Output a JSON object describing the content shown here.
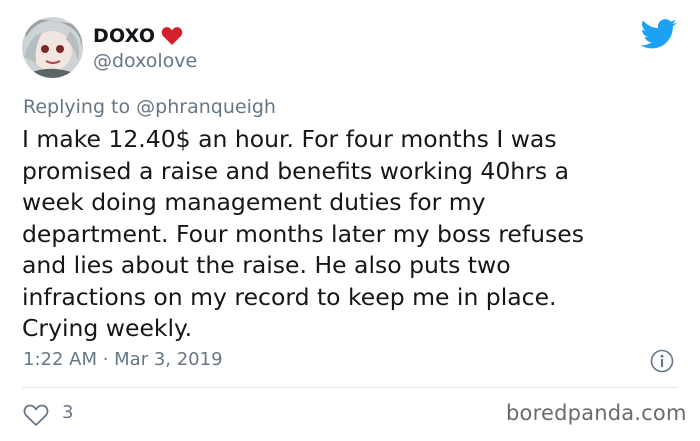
{
  "author": {
    "display_name": "DOXO",
    "handle": "@doxolove",
    "avatar_icon": "avatar-anime-character",
    "name_emoji": "heart-icon",
    "heart_color": "#d4202a"
  },
  "reply": {
    "prefix": "Replying to",
    "user": "@phranqueigh"
  },
  "tweet": {
    "lines": [
      "I make 12.40$ an hour. For four months I was",
      "promised a raise and benefits working 40hrs a",
      "week doing management duties for my",
      "department. Four months later my boss refuses",
      "and lies about the raise. He also puts two",
      "infractions on my record to keep me in place.",
      "Crying weekly."
    ],
    "timestamp": "1:22 AM · Mar 3, 2019",
    "likes": "3"
  },
  "watermark": "boredpanda.com",
  "colors": {
    "twitter_blue": "#1da1f2",
    "text": "#14171a",
    "muted": "#657786"
  }
}
